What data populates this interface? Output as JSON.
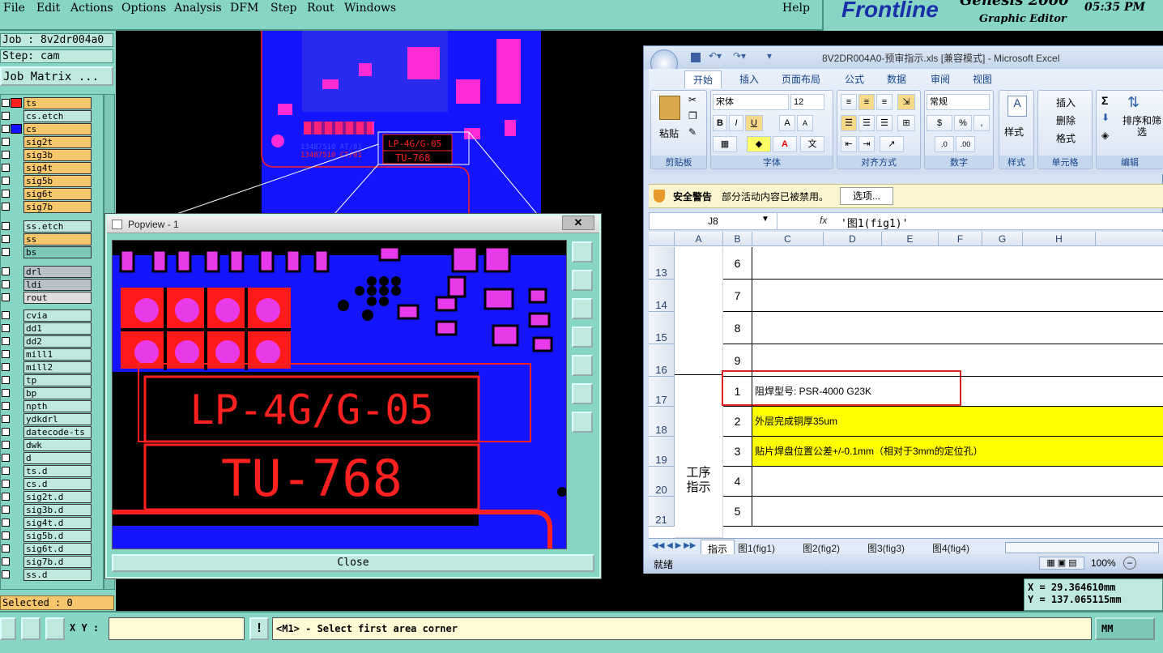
{
  "menubar": {
    "items": [
      "File",
      "Edit",
      "Actions",
      "Options",
      "Analysis",
      "DFM",
      "Step",
      "Rout",
      "Windows"
    ],
    "help": "Help"
  },
  "brand": {
    "logo": "Frontline",
    "product": "Genesis 2000",
    "subtitle": "Graphic Editor",
    "time": "05:35 PM"
  },
  "job": {
    "job_label": "Job : 8v2dr004a0",
    "step_label": "Step: cam",
    "matrix_button": "Job Matrix ..."
  },
  "layers": [
    {
      "name": "ts",
      "color": "#f6c66d"
    },
    {
      "name": "cs.etch",
      "color": "#bfe9df"
    },
    {
      "name": "cs",
      "color": "#f6c66d"
    },
    {
      "name": "sig2t",
      "color": "#f6c66d"
    },
    {
      "name": "sig3b",
      "color": "#f6c66d"
    },
    {
      "name": "sig4t",
      "color": "#f6c66d"
    },
    {
      "name": "sig5b",
      "color": "#f6c66d"
    },
    {
      "name": "sig6t",
      "color": "#f6c66d"
    },
    {
      "name": "sig7b",
      "color": "#f6c66d"
    },
    {
      "name": "ss.etch",
      "color": "#bfe9df"
    },
    {
      "name": "ss",
      "color": "#f6c66d"
    },
    {
      "name": "bs",
      "color": "#7cc8b8"
    },
    {
      "name": "drl",
      "color": "#b7c3c9"
    },
    {
      "name": "ldi",
      "color": "#b7c3c9"
    },
    {
      "name": "rout",
      "color": "#dddddd"
    },
    {
      "name": "cvia",
      "color": "#bfe9df"
    },
    {
      "name": "dd1",
      "color": "#bfe9df"
    },
    {
      "name": "dd2",
      "color": "#bfe9df"
    },
    {
      "name": "mill1",
      "color": "#bfe9df"
    },
    {
      "name": "mill2",
      "color": "#bfe9df"
    },
    {
      "name": "tp",
      "color": "#bfe9df"
    },
    {
      "name": "bp",
      "color": "#bfe9df"
    },
    {
      "name": "npth",
      "color": "#bfe9df"
    },
    {
      "name": "ydkdrl",
      "color": "#bfe9df"
    },
    {
      "name": "datecode-ts",
      "color": "#bfe9df"
    },
    {
      "name": "dwk",
      "color": "#bfe9df"
    },
    {
      "name": "d",
      "color": "#bfe9df"
    },
    {
      "name": "ts.d",
      "color": "#bfe9df"
    },
    {
      "name": "cs.d",
      "color": "#bfe9df"
    },
    {
      "name": "sig2t.d",
      "color": "#bfe9df"
    },
    {
      "name": "sig3b.d",
      "color": "#bfe9df"
    },
    {
      "name": "sig4t.d",
      "color": "#bfe9df"
    },
    {
      "name": "sig5b.d",
      "color": "#bfe9df"
    },
    {
      "name": "sig6t.d",
      "color": "#bfe9df"
    },
    {
      "name": "sig7b.d",
      "color": "#bfe9df"
    },
    {
      "name": "ss.d",
      "color": "#bfe9df"
    }
  ],
  "selected": "Selected : 0",
  "canvas": {
    "text1": "LP-4G/G-05",
    "text2": "TU-768",
    "part1": "13487510 AT/01",
    "part2": "13487510 CT/01"
  },
  "popview": {
    "title": "Popview - 1",
    "text1": "LP-4G/G-05",
    "text2": "TU-768",
    "close_label": "Close"
  },
  "excel": {
    "title": "8V2DR004A0-预审指示.xls [兼容模式] - Microsoft Excel",
    "tabs": [
      "开始",
      "插入",
      "页面布局",
      "公式",
      "数据",
      "审阅",
      "视图"
    ],
    "font_name": "宋体",
    "font_size": "12",
    "number_format": "常规",
    "groups": [
      "剪贴板",
      "字体",
      "对齐方式",
      "数字",
      "样式",
      "单元格",
      "编辑"
    ],
    "paste_label": "粘贴",
    "style_label": "样式",
    "insert_label": "插入",
    "delete_label": "删除",
    "format_label": "格式",
    "sort_label": "排序和筛选",
    "security_label": "安全警告",
    "security_msg": "部分活动内容已被禁用。",
    "options_button": "选项...",
    "name_box": "J8",
    "formula": "'图1(fig1)'",
    "columns": [
      "A",
      "B",
      "C",
      "D",
      "E",
      "F",
      "G",
      "H"
    ],
    "rows": [
      {
        "num": "13",
        "b": "6",
        "c": ""
      },
      {
        "num": "14",
        "b": "7",
        "c": ""
      },
      {
        "num": "15",
        "b": "8",
        "c": ""
      },
      {
        "num": "16",
        "b": "9",
        "c": ""
      },
      {
        "num": "17",
        "b": "1",
        "c": "阻焊型号: PSR-4000 G23K"
      },
      {
        "num": "18",
        "b": "2",
        "c": "外层完成铜厚35um"
      },
      {
        "num": "19",
        "b": "3",
        "c": "贴片焊盘位置公差+/-0.1mm（相对于3mm的定位孔）"
      },
      {
        "num": "20",
        "b": "4",
        "c": ""
      },
      {
        "num": "21",
        "b": "5",
        "c": ""
      }
    ],
    "merged_label": "工序\n指示",
    "sheets": [
      "指示",
      "图1(fig1)",
      "图2(fig2)",
      "图3(fig3)",
      "图4(fig4)"
    ],
    "status": "就绪",
    "zoom": "100%"
  },
  "coords": {
    "x": "X = 29.364610mm",
    "y": "Y = 137.065115mm"
  },
  "bottom": {
    "xy_label": "X Y :",
    "xy_value": "",
    "prompt": "<M1> - Select first area corner",
    "units": "MM"
  }
}
